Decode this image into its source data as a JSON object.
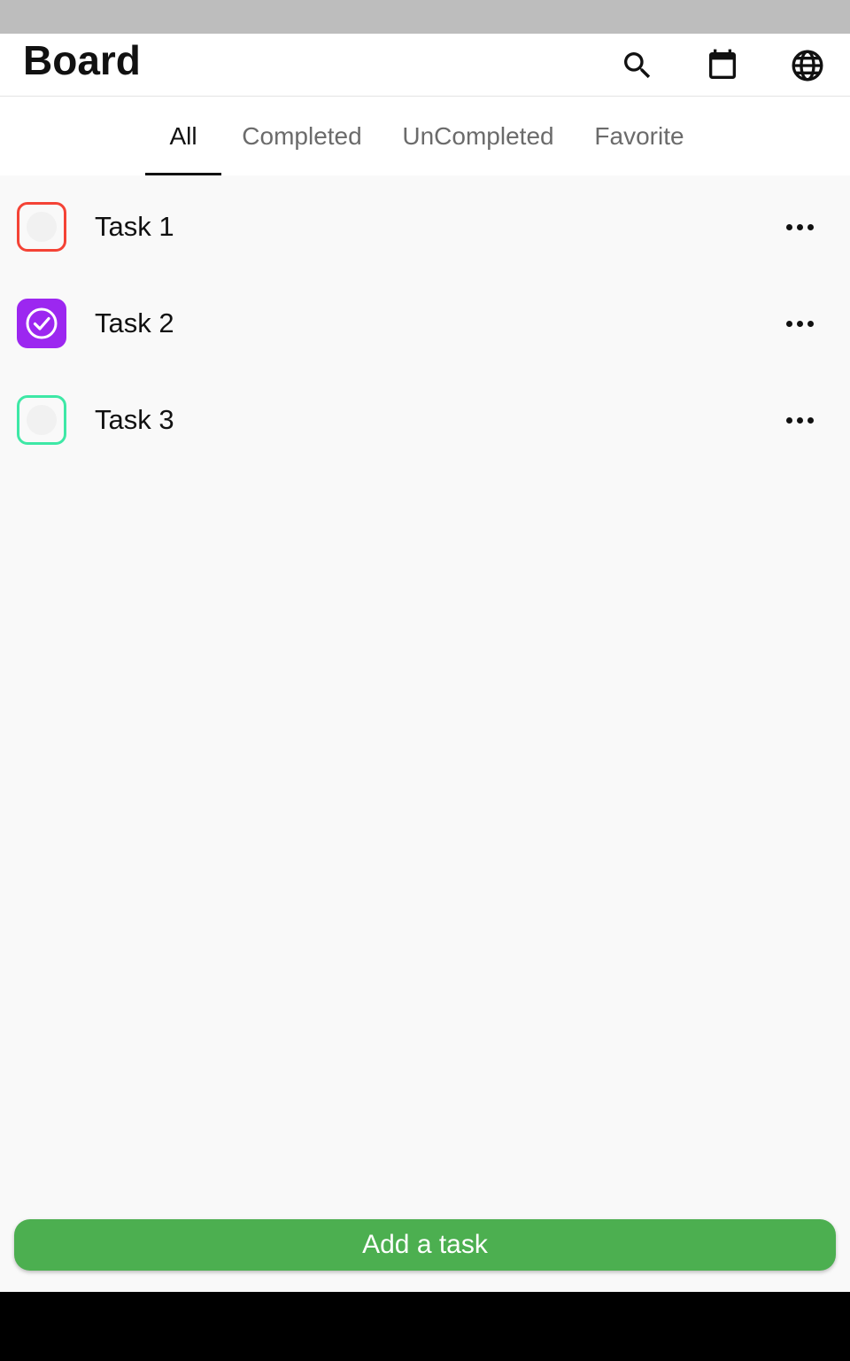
{
  "app": {
    "title": "Board",
    "icons": [
      "search-icon",
      "calendar-icon",
      "globe-icon"
    ]
  },
  "tabs": [
    {
      "label": "All",
      "active": true
    },
    {
      "label": "Completed",
      "active": false
    },
    {
      "label": "UnCompleted",
      "active": false
    },
    {
      "label": "Favorite",
      "active": false
    }
  ],
  "tasks": [
    {
      "label": "Task 1",
      "completed": false,
      "color": "#f44336"
    },
    {
      "label": "Task 2",
      "completed": true,
      "color": "#9c27f0"
    },
    {
      "label": "Task 3",
      "completed": false,
      "color": "#3ee8a6"
    }
  ],
  "add_button": {
    "label": "Add a task",
    "color": "#4caf50"
  }
}
